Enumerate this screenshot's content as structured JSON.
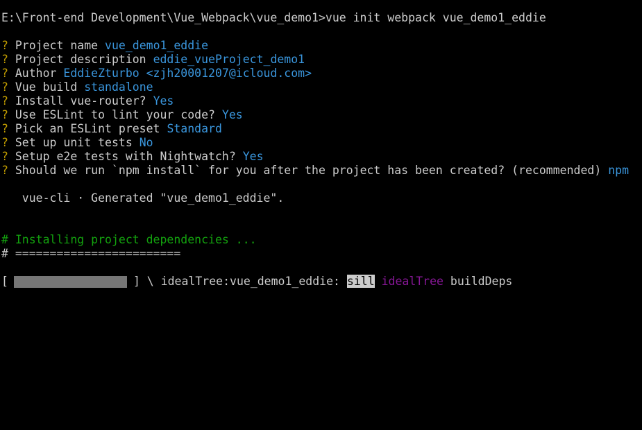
{
  "command_line": {
    "prompt": "E:\\Front-end Development\\Vue_Webpack\\vue_demo1>",
    "command": "vue init webpack vue_demo1_eddie"
  },
  "prompts": [
    {
      "marker": "?",
      "question": "Project name",
      "answer": "vue_demo1_eddie"
    },
    {
      "marker": "?",
      "question": "Project description",
      "answer": "eddie_vueProject_demo1"
    },
    {
      "marker": "?",
      "question": "Author",
      "answer": "EddieZturbo <zjh20001207@icloud.com>"
    },
    {
      "marker": "?",
      "question": "Vue build",
      "answer": "standalone"
    },
    {
      "marker": "?",
      "question": "Install vue-router?",
      "answer": "Yes"
    },
    {
      "marker": "?",
      "question": "Use ESLint to lint your code?",
      "answer": "Yes"
    },
    {
      "marker": "?",
      "question": "Pick an ESLint preset",
      "answer": "Standard"
    },
    {
      "marker": "?",
      "question": "Set up unit tests",
      "answer": "No"
    },
    {
      "marker": "?",
      "question": "Setup e2e tests with Nightwatch?",
      "answer": "Yes"
    },
    {
      "marker": "?",
      "question": "Should we run `npm install` for you after the project has been created? (recommended)",
      "answer": "npm"
    }
  ],
  "generated_line": "   vue-cli · Generated \"vue_demo1_eddie\".",
  "installing": {
    "hash": "#",
    "text": "Installing project dependencies ...",
    "separator": "# ========================"
  },
  "progress": {
    "open_bracket": "[",
    "close_bracket": "]",
    "fraction": 0.95,
    "spinner_text": " \\ idealTree:vue_demo1_eddie: ",
    "sill": "sill",
    "idealtree": "idealTree",
    "build": "buildDeps"
  },
  "colors": {
    "background": "#000000",
    "foreground": "#cccccc",
    "prompt_marker": "#c19c00",
    "answer": "#3a96dd",
    "installing": "#13a10e",
    "idealtree": "#881798",
    "progress_fill": "#767676"
  }
}
